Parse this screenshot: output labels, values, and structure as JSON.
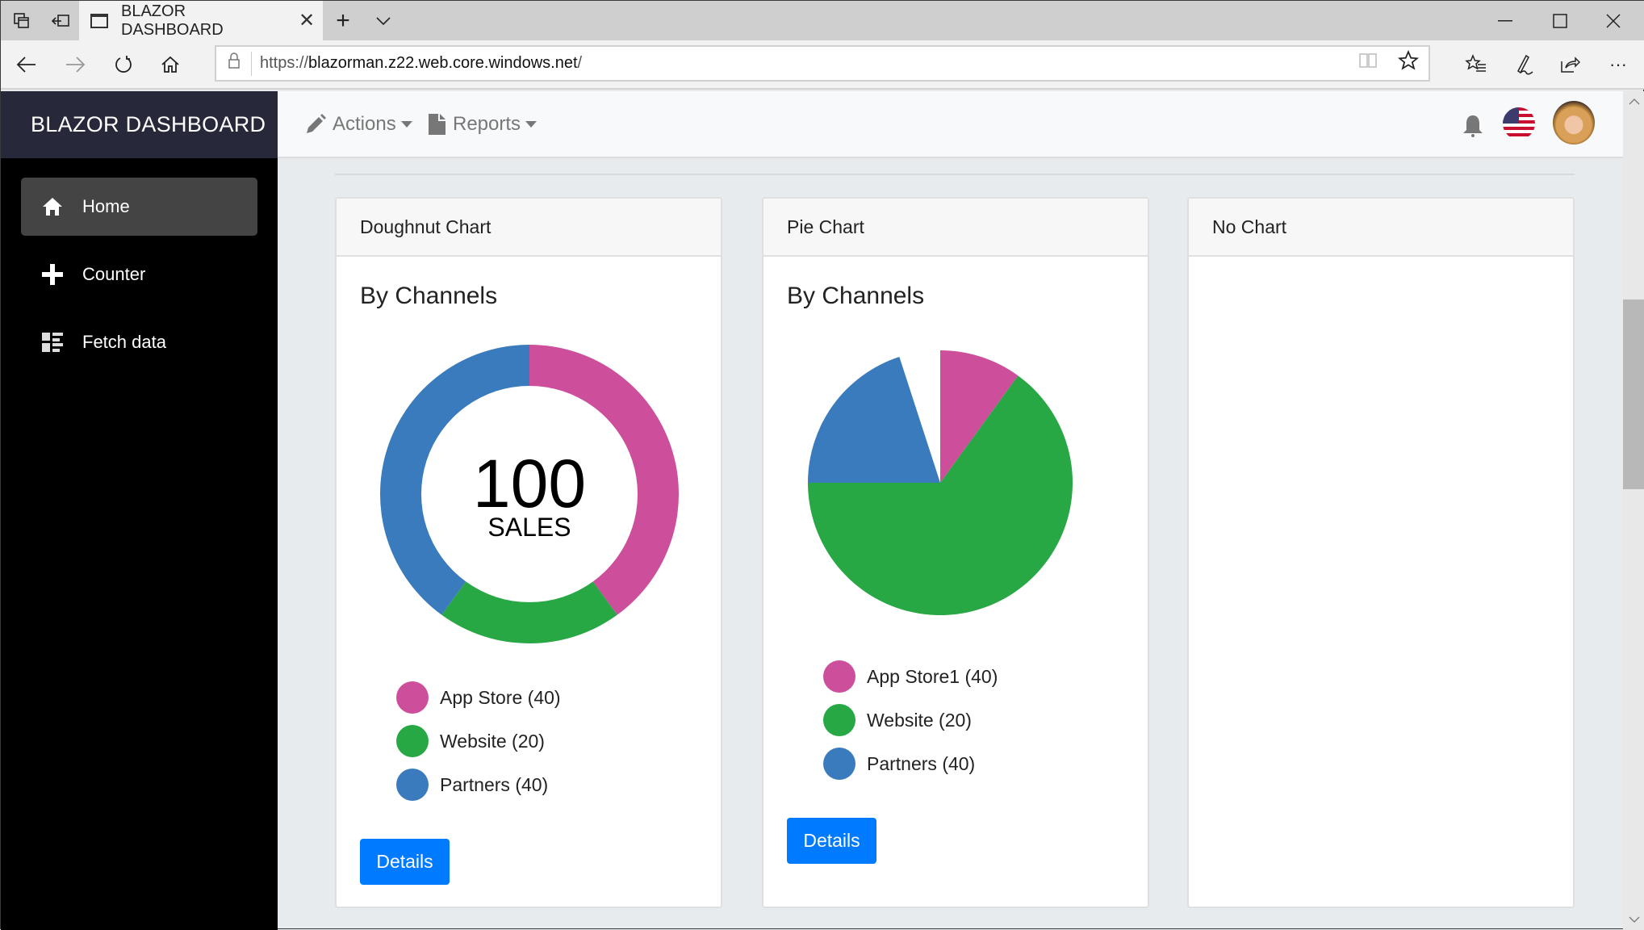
{
  "browser": {
    "tab_title": "BLAZOR DASHBOARD",
    "url_scheme": "https://",
    "url_host": "blazorman.z22.web.core.windows.net",
    "url_path": "/",
    "icons": {
      "tab_actions": "tab-actions-icon",
      "set_aside": "set-aside-tabs-icon",
      "new_tab": "+",
      "tab_list": "⌵",
      "minimize": "—",
      "maximize": "☐",
      "close": "✕",
      "back": "←",
      "forward": "→",
      "refresh": "↻",
      "home": "⌂",
      "lock": "🔒",
      "reading_view": "📖",
      "favorite": "☆",
      "favorites_list": "☆≡",
      "notes": "✎",
      "share": "⇪",
      "more": "···"
    }
  },
  "sidebar": {
    "brand": "BLAZOR DASHBOARD",
    "items": [
      {
        "label": "Home",
        "icon": "home-icon",
        "active": true
      },
      {
        "label": "Counter",
        "icon": "plus-icon",
        "active": false
      },
      {
        "label": "Fetch data",
        "icon": "list-icon",
        "active": false
      }
    ]
  },
  "topbar": {
    "menus": [
      {
        "label": "Actions",
        "icon": "pencil-icon"
      },
      {
        "label": "Reports",
        "icon": "file-icon"
      }
    ],
    "notification_icon": "bell-icon",
    "language_icon": "us-flag-icon",
    "avatar_icon": "user-avatar"
  },
  "cards": [
    {
      "header": "Doughnut Chart",
      "title": "By Channels",
      "center_value": "100",
      "center_label": "SALES",
      "legend": [
        "App Store (40)",
        "Website (20)",
        "Partners (40)"
      ],
      "button": "Details"
    },
    {
      "header": "Pie Chart",
      "title": "By Channels",
      "legend": [
        "App Store1 (40)",
        "Website (20)",
        "Partners (40)"
      ],
      "button": "Details"
    },
    {
      "header": "No Chart"
    }
  ],
  "colors": {
    "pink": "#cd4f9c",
    "green": "#28a745",
    "blue": "#3a7bbd",
    "primary": "#007bff",
    "sidebar_bg": "#000000",
    "brand_bg": "#27293a"
  },
  "chart_data": [
    {
      "type": "pie",
      "variant": "doughnut",
      "title": "By Channels",
      "center_text": "100 SALES",
      "categories": [
        "App Store",
        "Website",
        "Partners"
      ],
      "values": [
        40,
        20,
        40
      ],
      "colors": [
        "#cd4f9c",
        "#28a745",
        "#3a7bbd"
      ],
      "start_angle": "top, clockwise",
      "legend_position": "bottom"
    },
    {
      "type": "pie",
      "title": "By Channels",
      "categories": [
        "App Store1",
        "Website",
        "Partners"
      ],
      "values": [
        40,
        20,
        40
      ],
      "rendered_fractions": [
        0.1,
        0.65,
        0.2
      ],
      "unfilled_fraction": 0.05,
      "colors": [
        "#cd4f9c",
        "#28a745",
        "#3a7bbd"
      ],
      "start_angle": "top, clockwise",
      "legend_position": "bottom"
    }
  ]
}
